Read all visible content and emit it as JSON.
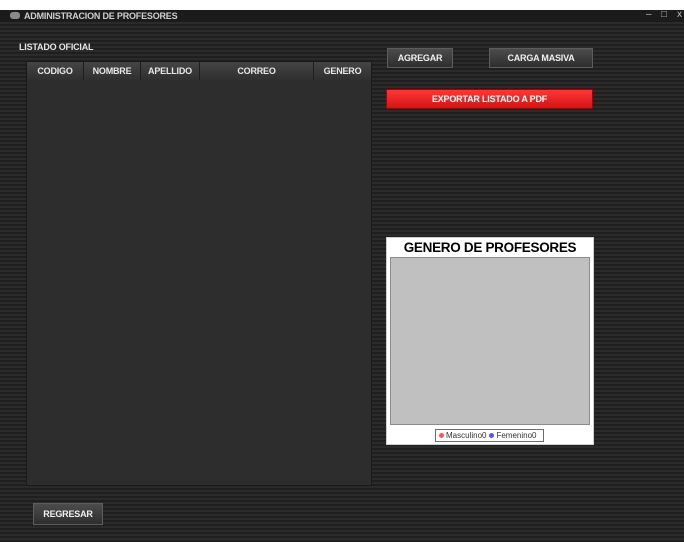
{
  "window": {
    "title": "ADMINISTRACION DE PROFESORES",
    "minimize_glyph": "–",
    "maximize_glyph": "□",
    "close_glyph": "x"
  },
  "table": {
    "label": "LISTADO OFICIAL",
    "columns": [
      "CODIGO",
      "NOMBRE",
      "APELLIDO",
      "CORREO",
      "GENERO"
    ],
    "rows": []
  },
  "buttons": {
    "agregar": "AGREGAR",
    "carga_masiva": "CARGA MASIVA",
    "exportar": "EXPORTAR LISTADO A PDF",
    "regresar": "REGRESAR"
  },
  "colors": {
    "export_button": "#ee1f1f",
    "masculino": "#ff5555",
    "femenino": "#5555ff",
    "plot_background": "#c0c0c0"
  },
  "chart_data": {
    "type": "pie",
    "title": "GENERO DE PROFESORES",
    "legend": "bottom",
    "series": [
      {
        "name": "Masculino0",
        "value": 0
      },
      {
        "name": "Femenino0",
        "value": 0
      }
    ]
  }
}
